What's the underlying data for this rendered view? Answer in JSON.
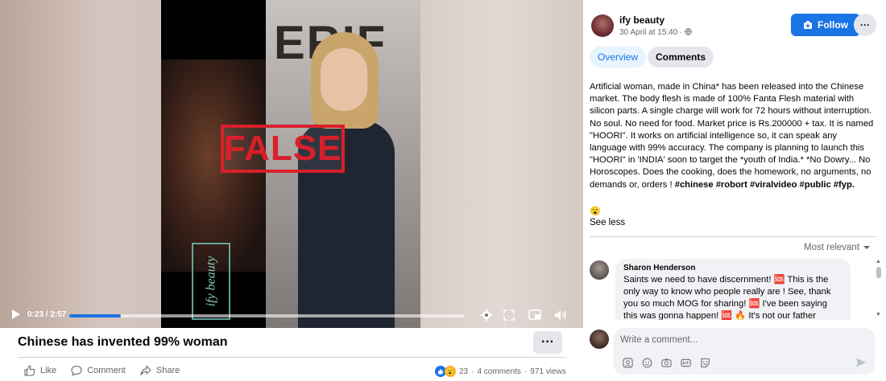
{
  "video": {
    "sign_text": "ERIF",
    "stamp_text": "FALSE",
    "watermark_text": "ify beauty",
    "time": "0:23 / 2:57",
    "progress": 0.13
  },
  "post": {
    "title": "Chinese has invented 99% woman",
    "actions": {
      "like": "Like",
      "comment": "Comment",
      "share": "Share"
    },
    "stats": {
      "reaction_count": "23",
      "separator1": "·",
      "comments": "4 comments",
      "separator2": "·",
      "views": "971 views"
    },
    "more_label": "···"
  },
  "panel": {
    "author": "ify beauty",
    "date": "30 April at 15:40 ·",
    "follow_label": "Follow",
    "more_label": "···",
    "tabs": {
      "overview": "Overview",
      "comments": "Comments"
    },
    "description_text": "Artificial woman, made in China* has been released into the Chinese market. The body flesh is made of 100% Fanta Flesh material with silicon parts. A single charge will work for 72 hours without interruption. No soul. No need for food. Market price is Rs.200000 + tax. It is named \"HOORI\". It works on artificial intelligence so, it can speak any language with 99% accuracy. The company is planning to launch this \"HOORI\" in 'INDIA' soon to target the *youth of India.* *No Dowry... No Horoscopes. Does the cooking, does the homework, no arguments, no demands or, orders ! ",
    "hashtags": "#chinese #robort #viralvideo #public #fyp.",
    "emoji": "😮",
    "see_less": "See less",
    "sort_label": "Most relevant",
    "comment": {
      "name": "Sharon Henderson",
      "text": "Saints we need to have discernment! 🆘 This is the only way to know who people really are ! See, thank you so much MOG for sharing! 🆘 I've been saying this was gonna happen! 🆘 🔥 It's not our father"
    },
    "write_placeholder": "Write a comment..."
  },
  "colors": {
    "accent": "#1b74e4",
    "stamp": "#d8202a"
  }
}
